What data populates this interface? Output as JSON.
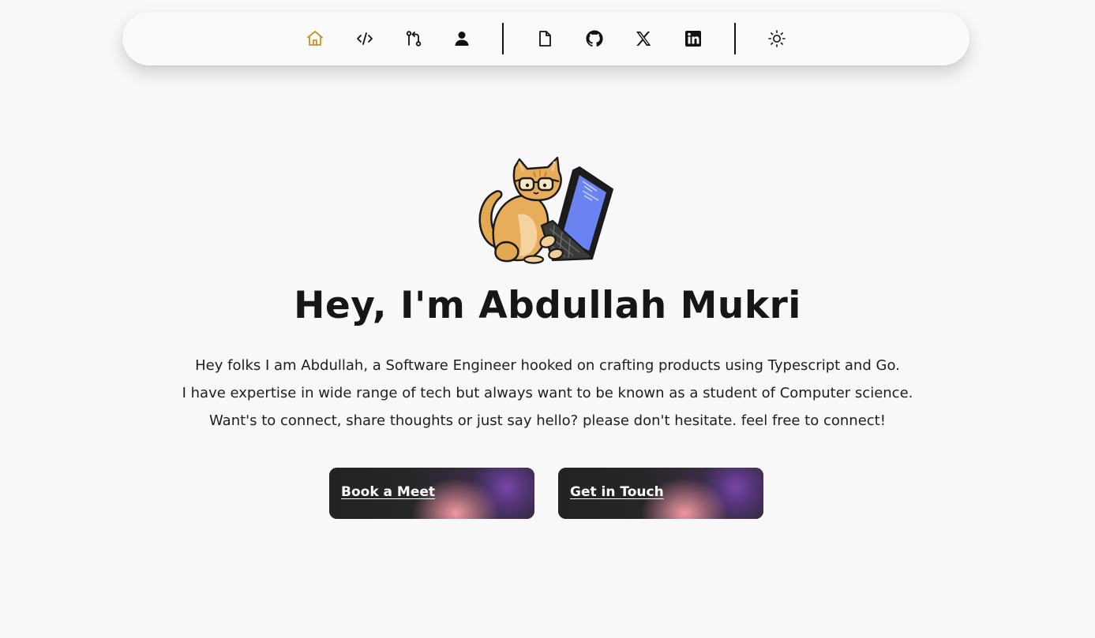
{
  "nav": {
    "items": [
      {
        "icon": "home-icon",
        "active": true
      },
      {
        "icon": "code-icon"
      },
      {
        "icon": "git-compare-icon"
      },
      {
        "icon": "user-icon"
      },
      {
        "icon": "file-icon"
      },
      {
        "icon": "github-icon"
      },
      {
        "icon": "x-twitter-icon"
      },
      {
        "icon": "linkedin-icon"
      },
      {
        "icon": "sun-icon"
      }
    ],
    "active_color": "#c8922a"
  },
  "hero": {
    "image": "cat-laptop-illustration",
    "title": "Hey, I'm Abdullah Mukri",
    "bio": [
      "Hey folks I am Abdullah, a Software Engineer hooked on crafting products using Typescript and Go.",
      "I have expertise in wide range of tech but always want to be known as a student of Computer science.",
      "Want's to connect, share thoughts or just say hello? please don't hesitate. feel free to connect!"
    ]
  },
  "buttons": {
    "book_meet": "Book a Meet",
    "get_in_touch": "Get in Touch"
  }
}
